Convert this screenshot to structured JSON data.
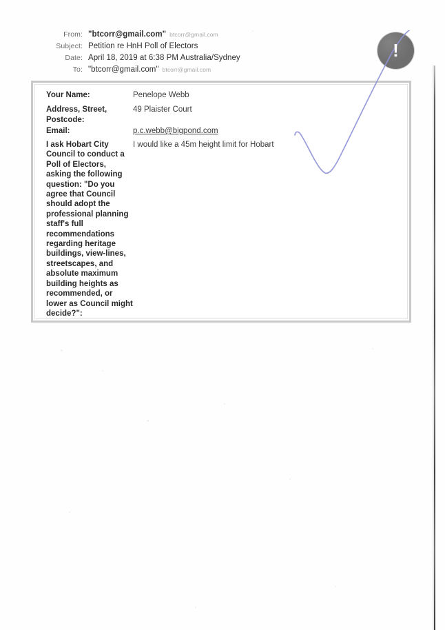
{
  "document": {
    "type": "scanned-email-petition"
  },
  "email_header": {
    "rows": [
      {
        "label": "From:",
        "value": "\"btcorr@gmail.com\"",
        "sub": "btcorr@gmail.com",
        "bold": true
      },
      {
        "label": "Subject:",
        "value": "Petition re HnH Poll of Electors",
        "sub": "",
        "bold": false
      },
      {
        "label": "Date:",
        "value": "April 18, 2019 at 6:38 PM Australia/Sydney",
        "sub": "",
        "bold": false
      },
      {
        "label": "To:",
        "value": "\"btcorr@gmail.com\"",
        "sub": "btcorr@gmail.com",
        "bold": false
      }
    ]
  },
  "badge": {
    "icon": "exclamation-icon",
    "mark": "!",
    "color": "#6e6e6e"
  },
  "form": {
    "fields": [
      {
        "label": "Your Name:",
        "value": "Penelope Webb",
        "link": false
      },
      {
        "label": "Address, Street, Postcode:",
        "value": "49 Plaister Court",
        "link": false
      },
      {
        "label": "Email:",
        "value": "p.c.webb@bigpond.com",
        "link": true
      },
      {
        "label": "I ask Hobart City Council to conduct a Poll of Electors, asking the following question: \"Do you agree that Council should adopt the professional planning staff's full recommendations regarding heritage buildings, view-lines, streetscapes, and absolute maximum building heights as recommended, or lower as Council might decide?\":",
        "value": "I would like a 45m height limit for Hobart",
        "link": false
      }
    ]
  },
  "annotation": {
    "name": "handwritten-checkmark",
    "color": "#8f93d6"
  },
  "colors": {
    "page_background": "#fefefe",
    "box_border": "#c9c9c9",
    "header_label": "#6f6f6f",
    "faint_text": "#a9a9ad",
    "body_text": "#3d3d3d"
  }
}
